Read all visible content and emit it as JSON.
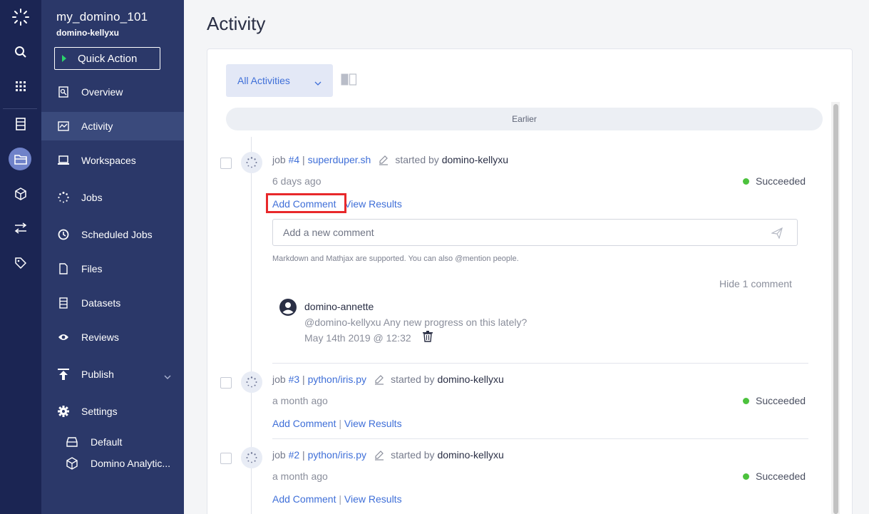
{
  "rail": {
    "icons": [
      "domino-logo-icon",
      "search-icon",
      "apps-grid-icon",
      "project-list-icon",
      "folder-icon",
      "cube-icon",
      "transfer-icon",
      "tag-icon"
    ]
  },
  "project": {
    "name": "my_domino_101",
    "owner": "domino-kellyxu",
    "quick_action": "Quick Action"
  },
  "nav": {
    "items": [
      {
        "label": "Overview",
        "icon": "overview-icon"
      },
      {
        "label": "Activity",
        "icon": "activity-icon",
        "active": true
      },
      {
        "label": "Workspaces",
        "icon": "workspaces-icon"
      },
      {
        "label": "Jobs",
        "icon": "jobs-icon"
      },
      {
        "label": "Scheduled Jobs",
        "icon": "clock-icon"
      },
      {
        "label": "Files",
        "icon": "file-icon"
      },
      {
        "label": "Datasets",
        "icon": "datasets-icon"
      },
      {
        "label": "Reviews",
        "icon": "eye-icon"
      },
      {
        "label": "Publish",
        "icon": "publish-icon"
      },
      {
        "label": "Settings",
        "icon": "gear-icon"
      }
    ],
    "sub_items": [
      {
        "label": "Default",
        "icon": "hardware-tier-icon"
      },
      {
        "label": "Domino Analytic...",
        "icon": "environment-cube-icon"
      }
    ]
  },
  "main": {
    "title": "Activity",
    "filter": "All Activities",
    "group_label": "Earlier",
    "jobs": [
      {
        "prefix": "job",
        "number": "#4",
        "sep": "|",
        "script": "superduper.sh",
        "started_by": "started by",
        "user": "domino-kellyxu",
        "ago": "6 days ago",
        "status": "Succeeded",
        "add_comment": "Add Comment",
        "divider": "|",
        "view_results": "View Results"
      },
      {
        "prefix": "job",
        "number": "#3",
        "sep": "|",
        "script": "python/iris.py",
        "started_by": "started by",
        "user": "domino-kellyxu",
        "ago": "a month ago",
        "status": "Succeeded",
        "add_comment": "Add Comment",
        "divider": "|",
        "view_results": "View Results"
      },
      {
        "prefix": "job",
        "number": "#2",
        "sep": "|",
        "script": "python/iris.py",
        "started_by": "started by",
        "user": "domino-kellyxu",
        "ago": "a month ago",
        "status": "Succeeded",
        "add_comment": "Add Comment",
        "divider": "|",
        "view_results": "View Results"
      }
    ],
    "comment_box": {
      "placeholder": "Add a new comment",
      "note": "Markdown and Mathjax are supported. You can also @mention people.",
      "hide_label": "Hide 1 comment"
    },
    "comment": {
      "author": "domino-annette",
      "body": "@domino-kellyxu Any new progress on this lately?",
      "date": "May 14th 2019 @ 12:32"
    },
    "colors": {
      "rail": "#1b2553",
      "sidebar": "#2b3869",
      "link": "#3f6fd8",
      "success": "#4cc23d",
      "highlight": "#e8282b"
    }
  }
}
